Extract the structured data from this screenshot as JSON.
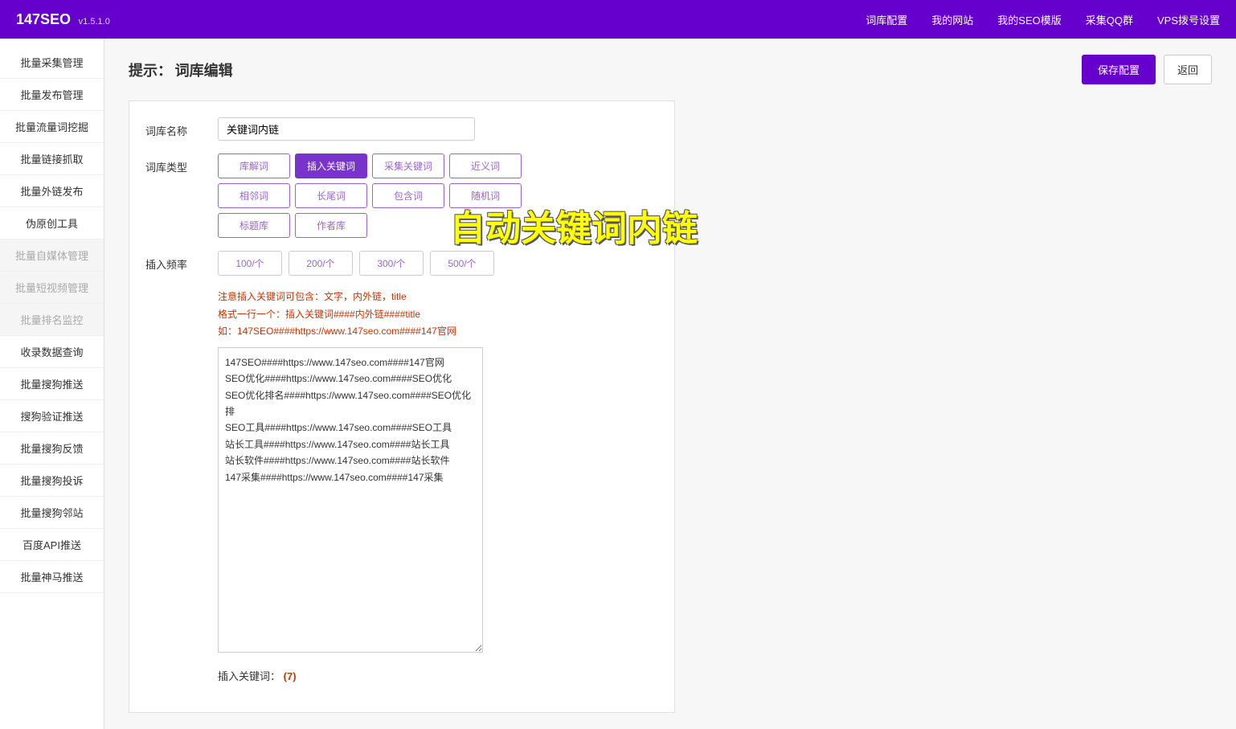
{
  "header": {
    "logo": "147SEO",
    "version": "v1.5.1.0",
    "nav": [
      {
        "label": "词库配置",
        "name": "nav-wordlib"
      },
      {
        "label": "我的网站",
        "name": "nav-mysite"
      },
      {
        "label": "我的SEO模版",
        "name": "nav-seotemplate"
      },
      {
        "label": "采集QQ群",
        "name": "nav-qqgroup"
      },
      {
        "label": "VPS拨号设置",
        "name": "nav-vps"
      }
    ]
  },
  "sidebar": {
    "items": [
      {
        "label": "批量采集管理",
        "disabled": false
      },
      {
        "label": "批量发布管理",
        "disabled": false
      },
      {
        "label": "批量流量词挖掘",
        "disabled": false
      },
      {
        "label": "批量链接抓取",
        "disabled": false
      },
      {
        "label": "批量外链发布",
        "disabled": false
      },
      {
        "label": "伪原创工具",
        "disabled": false
      },
      {
        "label": "批量自媒体管理",
        "disabled": true
      },
      {
        "label": "批量短视频管理",
        "disabled": true
      },
      {
        "label": "批量排名监控",
        "disabled": true
      },
      {
        "label": "收录数据查询",
        "disabled": false
      },
      {
        "label": "批量搜狗推送",
        "disabled": false
      },
      {
        "label": "搜狗验证推送",
        "disabled": false
      },
      {
        "label": "批量搜狗反馈",
        "disabled": false
      },
      {
        "label": "批量搜狗投诉",
        "disabled": false
      },
      {
        "label": "批量搜狗邻站",
        "disabled": false
      },
      {
        "label": "百度API推送",
        "disabled": false
      },
      {
        "label": "批量神马推送",
        "disabled": false
      }
    ]
  },
  "page": {
    "hint_prefix": "提示：",
    "title": "词库编辑",
    "save_button": "保存配置",
    "back_button": "返回"
  },
  "form": {
    "name_label": "词库名称",
    "name_value": "关键词内链",
    "type_label": "词库类型",
    "type_buttons": [
      {
        "label": "库解词",
        "active": false
      },
      {
        "label": "插入关键词",
        "active": true
      },
      {
        "label": "采集关键词",
        "active": false
      },
      {
        "label": "近义词",
        "active": false
      },
      {
        "label": "相邻词",
        "active": false
      },
      {
        "label": "长尾词",
        "active": false
      },
      {
        "label": "包含词",
        "active": false
      },
      {
        "label": "随机词",
        "active": false
      },
      {
        "label": "标题库",
        "active": false
      },
      {
        "label": "作者库",
        "active": false
      }
    ],
    "freq_label": "插入频率",
    "freq_buttons": [
      {
        "label": "100/个"
      },
      {
        "label": "200/个"
      },
      {
        "label": "300/个"
      },
      {
        "label": "500/个"
      }
    ],
    "hint_lines": [
      "注意插入关键词可包含：文字，内外链，title",
      "格式一行一个：插入关键词####内外链####title",
      "如：147SEO####https://www.147seo.com####147官网"
    ],
    "textarea_content": "147SEO####https://www.147seo.com####147官网\nSEO优化####https://www.147seo.com####SEO优化\nSEO优化排名####https://www.147seo.com####SEO优化排\nSEO工具####https://www.147seo.com####SEO工具\n站长工具####https://www.147seo.com####站长工具\n站长软件####https://www.147seo.com####站长软件\n147采集####https://www.147seo.com####147采集",
    "insert_label": "插入关键词：",
    "insert_count": "(7)"
  },
  "big_title": "自动关键词内链"
}
